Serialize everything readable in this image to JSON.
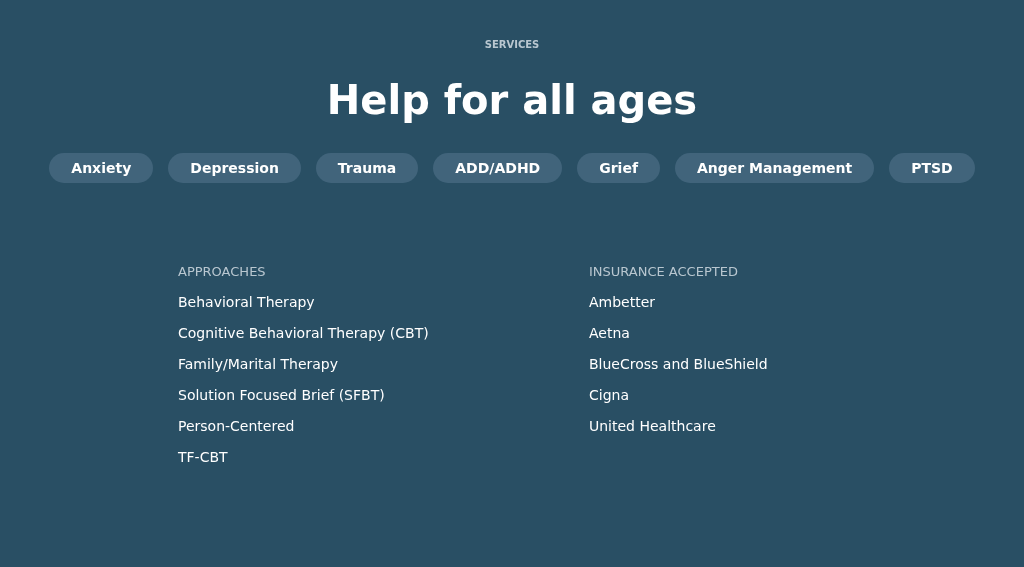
{
  "eyebrow": "SERVICES",
  "title": "Help for all ages",
  "tags": [
    "Anxiety",
    "Depression",
    "Trauma",
    "ADD/ADHD",
    "Grief",
    "Anger Management",
    "PTSD"
  ],
  "lists": [
    {
      "heading": "APPROACHES",
      "items": [
        "Behavioral Therapy",
        "Cognitive Behavioral Therapy (CBT)",
        "Family/Marital Therapy",
        "Solution Focused Brief (SFBT)",
        "Person-Centered",
        "TF-CBT"
      ]
    },
    {
      "heading": "INSURANCE ACCEPTED",
      "items": [
        "Ambetter",
        "Aetna",
        "BlueCross and BlueShield",
        "Cigna",
        "United Healthcare"
      ]
    }
  ]
}
